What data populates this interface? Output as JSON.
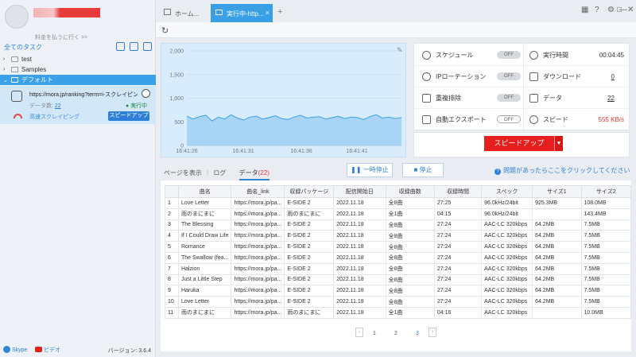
{
  "sidebar": {
    "pay_link": "料金を払うに行く >>",
    "all_tasks": "全てのタスク",
    "tree": [
      {
        "label": "test",
        "expanded": false,
        "selected": false
      },
      {
        "label": "Samples",
        "expanded": false,
        "selected": false
      },
      {
        "label": "デフォルト",
        "expanded": true,
        "selected": true
      }
    ],
    "task": {
      "url": "https://mora.jp/ranking?term=i-スクレイピング...",
      "data_count_label": "データ数:",
      "data_count": "22",
      "status": "実行中",
      "mode": "高速スクレイピング",
      "speedup": "スピードアップ"
    },
    "footer": {
      "skype": "Skype",
      "video": "ビデオ",
      "version": "バージョン: 3.6.4"
    }
  },
  "tabs": {
    "home": "ホーム...",
    "active": "実行中-http...",
    "close": "×",
    "add": "+"
  },
  "window_controls": [
    "▦",
    "?",
    "⚙",
    "—",
    "□",
    "✕"
  ],
  "chart_data": {
    "type": "area",
    "x": [
      "16:41:26",
      "16:41:31",
      "16:41:36",
      "16:41:41"
    ],
    "yticks": [
      0,
      500,
      1000,
      1500,
      2000
    ],
    "ylim": [
      0,
      2000
    ],
    "series": [
      {
        "values": [
          620,
          560,
          610,
          640,
          520,
          600,
          560,
          650,
          580,
          540,
          600,
          620,
          560,
          590,
          630,
          570,
          550,
          600,
          640,
          580,
          600,
          610,
          560,
          590,
          620,
          570,
          600,
          590,
          550,
          610,
          650,
          580,
          600,
          570,
          590
        ]
      }
    ],
    "color": "#3aa0e8"
  },
  "stats": {
    "schedule": "スケジュール",
    "schedule_state": "OFF",
    "ip_rotation": "IPローテーション",
    "ip_state": "OFF",
    "dedupe": "重複排除",
    "dedupe_state": "OFF",
    "auto_export": "自動エクスポート",
    "auto_export_state": "OFF",
    "runtime_label": "実行時間",
    "runtime": "00:04:45",
    "download_label": "ダウンロード",
    "download": "0",
    "data_label": "データ",
    "data": "22",
    "speed_label": "スピード",
    "speed": "555 KB/s"
  },
  "speedup_button": "スピードアップ",
  "view_tabs": {
    "page": "ページを表示",
    "log": "ログ",
    "data": "データ",
    "data_count": "(22)"
  },
  "pause_button": "一時停止",
  "stop_button": "停止",
  "help": "問題があったらここをクリックしてください",
  "table": {
    "headers": [
      "",
      "曲名",
      "曲名_link",
      "収録パッケージ",
      "配信開始日",
      "収録曲数",
      "収録時間",
      "スペック",
      "サイズ1",
      "サイズ2"
    ],
    "rows": [
      [
        "1",
        "Love Letter",
        "https://mora.jp/pa...",
        "E-SIDE 2",
        "2022.11.18",
        "全8曲",
        "27:25",
        "96.0kHz/24bit",
        "925.3MB",
        "108.0MB"
      ],
      [
        "2",
        "雨のまにまに",
        "https://mora.jp/pa...",
        "雨のまにまに",
        "2022.11.18",
        "全1曲",
        "04:15",
        "96.0kHz/24bit",
        "",
        "143.4MB"
      ],
      [
        "3",
        "The Blessing",
        "https://mora.jp/pa...",
        "E-SIDE 2",
        "2022.11.18",
        "全8曲",
        "27:24",
        "AAC-LC 320kbps",
        "64.2MB",
        "7.5MB"
      ],
      [
        "4",
        "If I Could Draw Life",
        "https://mora.jp/pa...",
        "E-SIDE 2",
        "2022.11.18",
        "全8曲",
        "27:24",
        "AAC-LC 320kbps",
        "64.2MB",
        "7.5MB"
      ],
      [
        "5",
        "Romance",
        "https://mora.jp/pa...",
        "E-SIDE 2",
        "2022.11.18",
        "全8曲",
        "27:24",
        "AAC-LC 320kbps",
        "64.2MB",
        "7.5MB"
      ],
      [
        "6",
        "The Swallow (fea...",
        "https://mora.jp/pa...",
        "E-SIDE 2",
        "2022.11.18",
        "全8曲",
        "27:24",
        "AAC-LC 320kbps",
        "64.2MB",
        "7.5MB"
      ],
      [
        "7",
        "Halzion",
        "https://mora.jp/pa...",
        "E-SIDE 2",
        "2022.11.18",
        "全8曲",
        "27:24",
        "AAC-LC 320kbps",
        "64.2MB",
        "7.5MB"
      ],
      [
        "8",
        "Just a Little Step",
        "https://mora.jp/pa...",
        "E-SIDE 2",
        "2022.11.18",
        "全8曲",
        "27:24",
        "AAC-LC 320kbps",
        "64.2MB",
        "7.5MB"
      ],
      [
        "9",
        "Haruka",
        "https://mora.jp/pa...",
        "E-SIDE 2",
        "2022.11.18",
        "全8曲",
        "27:24",
        "AAC-LC 320kbps",
        "64.2MB",
        "7.5MB"
      ],
      [
        "10",
        "Love Letter",
        "https://mora.jp/pa...",
        "E-SIDE 2",
        "2022.11.18",
        "全8曲",
        "27:24",
        "AAC-LC 320kbps",
        "64.2MB",
        "7.5MB"
      ],
      [
        "11",
        "雨のまにまに",
        "https://mora.jp/pa...",
        "雨のまにまに",
        "2022.11.18",
        "全1曲",
        "04:16",
        "AAC-LC 320kbps",
        "",
        "10.0MB"
      ]
    ]
  },
  "pager": {
    "pages": [
      "1",
      "2",
      "3"
    ],
    "current": "3"
  }
}
